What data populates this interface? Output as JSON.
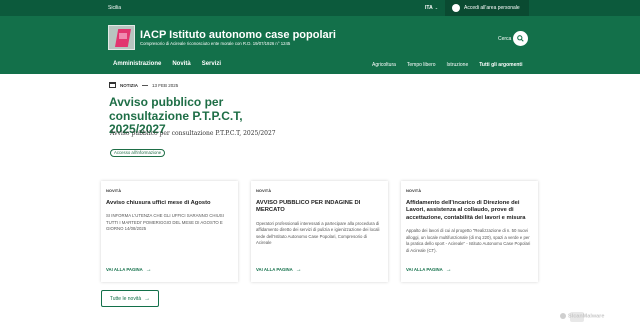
{
  "topbar": {
    "region": "Sicilia",
    "language": "ITA",
    "language_caret": "⌄",
    "login_label": "Accedi all'area personale"
  },
  "header": {
    "title": "IACP Istituto autonomo case popolari",
    "subtitle": "Compresorio di Acireale riconosciuto ente morale con R.D. 19/07/1926 n° 1245",
    "search_label": "Cerca",
    "search_icon": "search-icon"
  },
  "nav": {
    "main": [
      "Amministrazione",
      "Novità",
      "Servizi"
    ],
    "secondary": [
      "Agricoltura",
      "Tempo libero",
      "Istruzione"
    ],
    "all_topics": "Tutti gli argomenti"
  },
  "article": {
    "type": "NOTIZIA",
    "date": "13 FEB 2025",
    "title": "Avviso pubblico per consultazione P.T.P.C.T, 2025/2027",
    "lead": "Avviso pubblico per consultazione P.T.P.C.T, 2025/2027",
    "tag": "Accesso all'informazione"
  },
  "cards": [
    {
      "kicker": "NOVITÀ",
      "title": "Avviso chiusura uffici mese di Agosto",
      "text": "SI INFORMA L'UTENZA CHE GLI UFFICI SARANNO CHIUSI TUTTI I MARTEDI' POMERIGGIO DEL MESE DI AGOSTO E GIORNO 14/08/2025",
      "link": "VAI ALLA PAGINA"
    },
    {
      "kicker": "NOVITÀ",
      "title": "AVVISO PUBBLICO PER INDAGINE DI MERCATO",
      "text": "Operatori professionali interessati a partecipare alla procedura di affidamento diretto dei servizi di pulizia e igienizzazione dei locali sede dell'Istituto Autonomo Case Popolari, Compresorio di Acireale",
      "link": "VAI ALLA PAGINA"
    },
    {
      "kicker": "NOVITÀ",
      "title": "Affidamento dell'incarico di Direzione dei Lavori, assistenza al collaudo, prove di accettazione, contabilità dei lavori e misura",
      "text": "Appalto dei lavori di cui al progetto \"Realizzazione di n. 50 nuovi alloggi, un locale multifunzionale (di mq 220), spazi a verde e per la pratica dello sport - Acireale\" - Istituto Autonomo Case Popolari di Acireale (CT).",
      "link": "VAI ALLA PAGINA"
    }
  ],
  "all_news": "Tutte le novità",
  "arrow": "→",
  "watermark": "SlcanMalware"
}
